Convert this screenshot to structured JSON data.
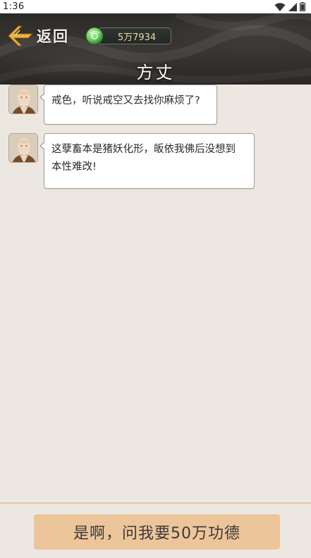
{
  "status_bar": {
    "time": "1:36"
  },
  "header": {
    "back_label": "返回",
    "currency_value": "5万7934",
    "title": "方丈"
  },
  "messages": [
    {
      "speaker": "方丈",
      "text": "戒色，听说戒空又去找你麻烦了?"
    },
    {
      "speaker": "方丈",
      "text_line1": "这孽畜本是猪妖化形，皈依我佛后没想到",
      "text_line2": "本性难改!"
    }
  ],
  "reply": {
    "label": "是啊，问我要50万功德"
  },
  "colors": {
    "header_bg": "#2C2A28",
    "page_bg": "#ECE8E1",
    "reply_button_bg": "#EDC59A",
    "currency_text": "#EED8A3",
    "divider": "#E0C7A6"
  },
  "icons": [
    "wifi-icon",
    "signal-icon",
    "battery-icon",
    "back-arrow-icon",
    "jade-currency-icon",
    "monk-avatar"
  ]
}
